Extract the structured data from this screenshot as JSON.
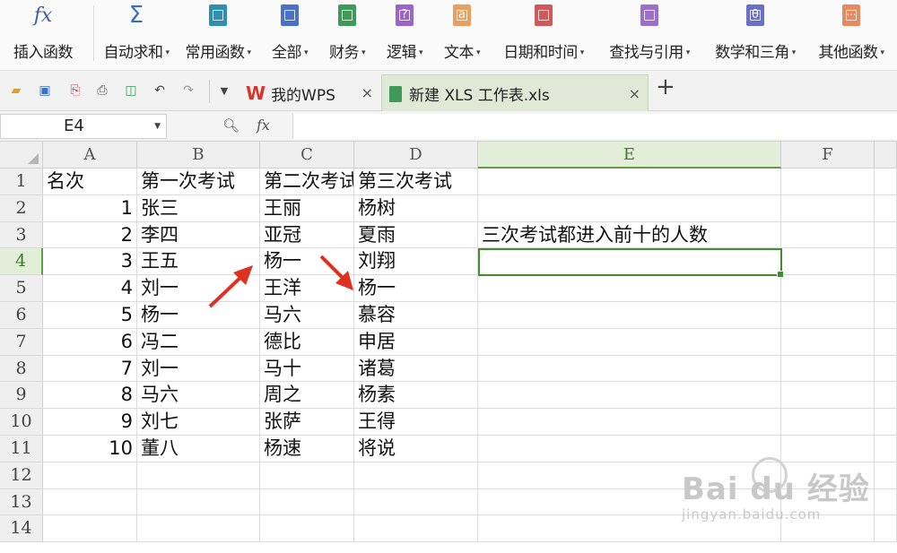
{
  "ribbon": {
    "items": [
      {
        "label": "插入函数",
        "icon": "fx-icon",
        "dropdown": false
      },
      {
        "label": "自动求和",
        "icon": "sigma-icon",
        "dropdown": true
      },
      {
        "label": "常用函数",
        "icon": "star-book-icon",
        "dropdown": true
      },
      {
        "label": "全部",
        "icon": "list-book-icon",
        "dropdown": true
      },
      {
        "label": "财务",
        "icon": "finance-book-icon",
        "dropdown": true
      },
      {
        "label": "逻辑",
        "icon": "question-book-icon",
        "dropdown": true
      },
      {
        "label": "文本",
        "icon": "text-book-icon",
        "dropdown": true
      },
      {
        "label": "日期和时间",
        "icon": "clock-book-icon",
        "dropdown": true
      },
      {
        "label": "查找与引用",
        "icon": "search-book-icon",
        "dropdown": true
      },
      {
        "label": "数学和三角",
        "icon": "theta-book-icon",
        "dropdown": true
      },
      {
        "label": "其他函数",
        "icon": "dots-book-icon",
        "dropdown": true
      }
    ],
    "icon_glyphs": {
      "fx": "fx",
      "sigma": "Σ",
      "logic": "?",
      "text": "a",
      "math": "θ",
      "other": "···"
    },
    "colors": {
      "fx": "#3a5fb0",
      "sigma": "#3a6fc0",
      "common": "#2f8fb0",
      "all": "#4a70c8",
      "finance": "#3f9a5a",
      "logic": "#9a64c8",
      "text": "#e8a060",
      "date": "#d05a5a",
      "lookup": "#9a70c8",
      "math": "#6a70c8",
      "other": "#e88a60"
    }
  },
  "tabs": {
    "wps": {
      "label": "我的WPS",
      "close": "×"
    },
    "xls": {
      "label": "新建 XLS 工作表.xls",
      "close": "×"
    },
    "add": "+"
  },
  "formula_bar": {
    "cell_ref": "E4",
    "fx": "fx",
    "value": ""
  },
  "columns": [
    "A",
    "B",
    "C",
    "D",
    "E",
    "F"
  ],
  "rows": [
    "1",
    "2",
    "3",
    "4",
    "5",
    "6",
    "7",
    "8",
    "9",
    "10",
    "11",
    "12",
    "13",
    "14"
  ],
  "cells": {
    "A1": "名次",
    "B1": "第一次考试",
    "C1": "第二次考试",
    "D1": "第三次考试",
    "A2": "1",
    "B2": "张三",
    "C2": "王丽",
    "D2": "杨树",
    "A3": "2",
    "B3": "李四",
    "C3": "亚冠",
    "D3": "夏雨",
    "E3": "三次考试都进入前十的人数",
    "A4": "3",
    "B4": "王五",
    "C4": "杨一",
    "D4": "刘翔",
    "A5": "4",
    "B5": "刘一",
    "C5": "王洋",
    "D5": "杨一",
    "A6": "5",
    "B6": "杨一",
    "C6": "马六",
    "D6": "慕容",
    "A7": "6",
    "B7": "冯二",
    "C7": "德比",
    "D7": "申居",
    "A8": "7",
    "B8": "刘一",
    "C8": "马十",
    "D8": "诸葛",
    "A9": "8",
    "B9": "马六",
    "C9": "周之",
    "D9": "杨素",
    "A10": "9",
    "B10": "刘七",
    "C10": "张萨",
    "D10": "王得",
    "A11": "10",
    "B11": "董八",
    "C11": "杨速",
    "D11": "将说"
  },
  "selected_cell": "E4",
  "watermark": {
    "title": "Bai du 经验",
    "sub": "jingyan.baidu.com"
  }
}
